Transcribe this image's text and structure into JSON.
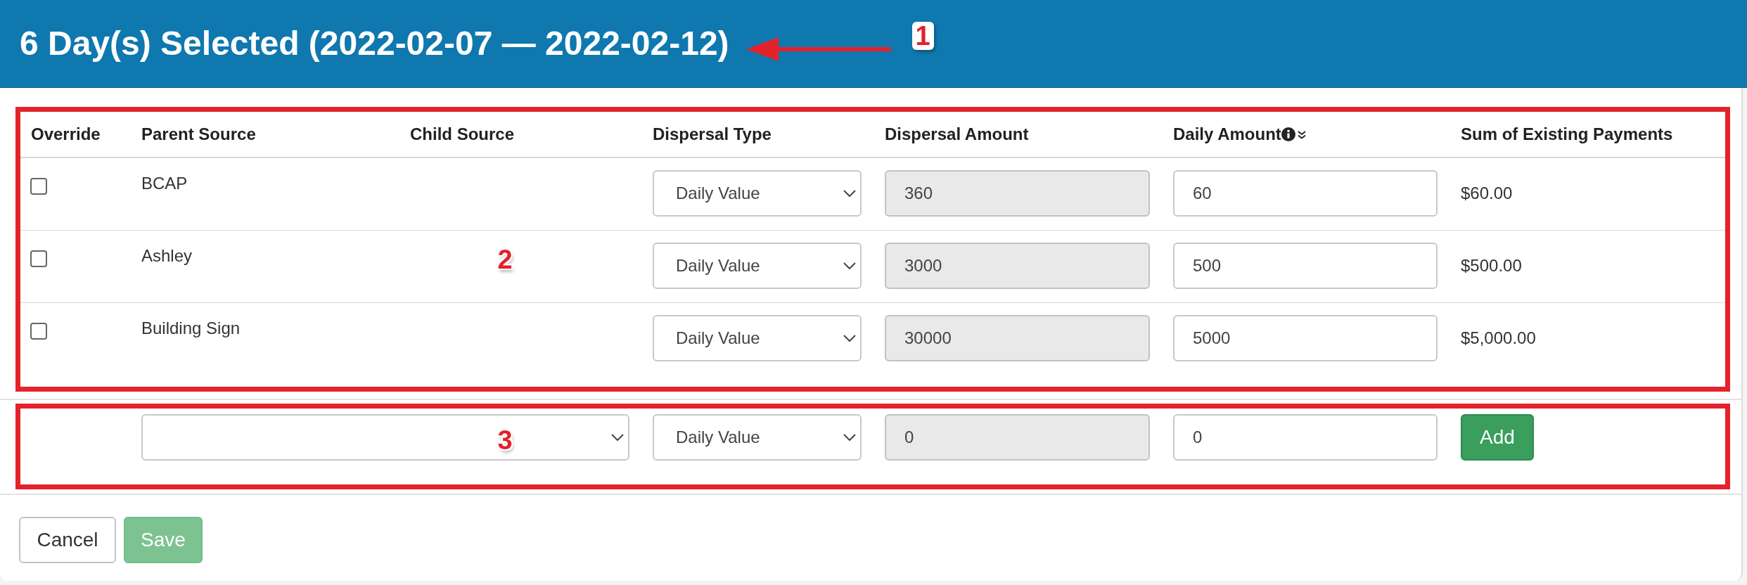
{
  "header": {
    "title": "6 Day(s) Selected (2022-02-07 — 2022-02-12)",
    "callout": {
      "kind": "arrow",
      "label": "1"
    }
  },
  "table": {
    "callout": {
      "kind": "box",
      "label": "2"
    },
    "columns": [
      {
        "label": "Override"
      },
      {
        "label": "Parent Source"
      },
      {
        "label": "Child Source"
      },
      {
        "label": "Dispersal Type"
      },
      {
        "label": "Dispersal Amount"
      },
      {
        "label": "Daily Amount",
        "info": true,
        "sort": true
      },
      {
        "label": "Sum of Existing Payments"
      }
    ],
    "rows": [
      {
        "checked": false,
        "parent_source": "BCAP",
        "dispersal_type": "Daily Value",
        "dispersal_amount": {
          "value": "360",
          "disabled": true
        },
        "daily_amount": {
          "value": "60",
          "disabled": false
        },
        "sum": "$60.00"
      },
      {
        "checked": false,
        "parent_source": "Ashley",
        "dispersal_type": "Daily Value",
        "dispersal_amount": {
          "value": "3000",
          "disabled": true
        },
        "daily_amount": {
          "value": "500",
          "disabled": false
        },
        "sum": "$500.00"
      },
      {
        "checked": false,
        "parent_source": "Building Sign",
        "dispersal_type": "Daily Value",
        "dispersal_amount": {
          "value": "30000",
          "disabled": true
        },
        "daily_amount": {
          "value": "5000",
          "disabled": false
        },
        "sum": "$5,000.00"
      }
    ]
  },
  "add_row": {
    "callout": {
      "kind": "box",
      "label": "3"
    },
    "fields": [
      {
        "kind": "source_select"
      },
      {
        "kind": "select",
        "value": "Daily Value"
      },
      {
        "kind": "input",
        "value": "0",
        "disabled": true
      },
      {
        "kind": "input",
        "value": "0",
        "disabled": false
      },
      {
        "kind": "button",
        "label": "Add",
        "disabled": false
      }
    ]
  },
  "footer": {
    "buttons": [
      {
        "label": "Cancel",
        "kind": "secondary",
        "disabled": false
      },
      {
        "label": "Save",
        "kind": "primary",
        "disabled": true
      }
    ]
  }
}
